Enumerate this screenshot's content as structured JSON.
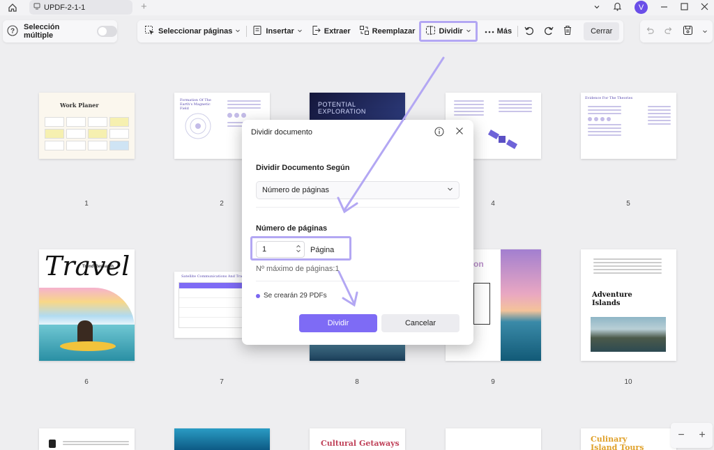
{
  "window": {
    "tab_title": "UPDF-2-1-1",
    "tab_plus": "+",
    "avatar_letter": "V"
  },
  "toolbar_left": {
    "multi_select_label": "Selección múltiple"
  },
  "toolbar": {
    "select_pages": "Seleccionar páginas",
    "insert": "Insertar",
    "extract": "Extraer",
    "replace": "Reemplazar",
    "split": "Dividir",
    "more": "Más",
    "close": "Cerrar"
  },
  "pages": [
    {
      "number": "1",
      "title": "Work Planer"
    },
    {
      "number": "2",
      "title": "Formation Of The Earth's Magnetic Field"
    },
    {
      "number": "3",
      "title": "POTENTIAL EXPLORATION"
    },
    {
      "number": "4",
      "title": ""
    },
    {
      "number": "5",
      "title": "Evidence For The Theories"
    },
    {
      "number": "6",
      "title": "Travel",
      "subtitle": "Trend Research"
    },
    {
      "number": "7",
      "title": "Satellite Communications And Travel"
    },
    {
      "number": "8",
      "title": ""
    },
    {
      "number": "9",
      "title": "on"
    },
    {
      "number": "10",
      "title": "Adventure Islands"
    },
    {
      "number": "",
      "title": ""
    },
    {
      "number": "",
      "title": ""
    },
    {
      "number": "",
      "title": "Cultural Getaways"
    },
    {
      "number": "",
      "title": ""
    },
    {
      "number": "",
      "title": "Culinary Island Tours"
    }
  ],
  "dialog": {
    "title": "Dividir documento",
    "split_by_label": "Dividir Documento Según",
    "split_by_value": "Número de páginas",
    "pages_label": "Número de páginas",
    "pages_value": "1",
    "pages_unit": "Página",
    "max_pages": "Nº máximo de páginas:1",
    "result_text": "Se crearán 29 PDFs",
    "confirm": "Dividir",
    "cancel": "Cancelar"
  },
  "zoom": {
    "minus": "−",
    "plus": "+"
  },
  "colors": {
    "accent": "#7e6bf5",
    "highlight": "#b3a7f3",
    "avatar": "#6a4ee8"
  }
}
